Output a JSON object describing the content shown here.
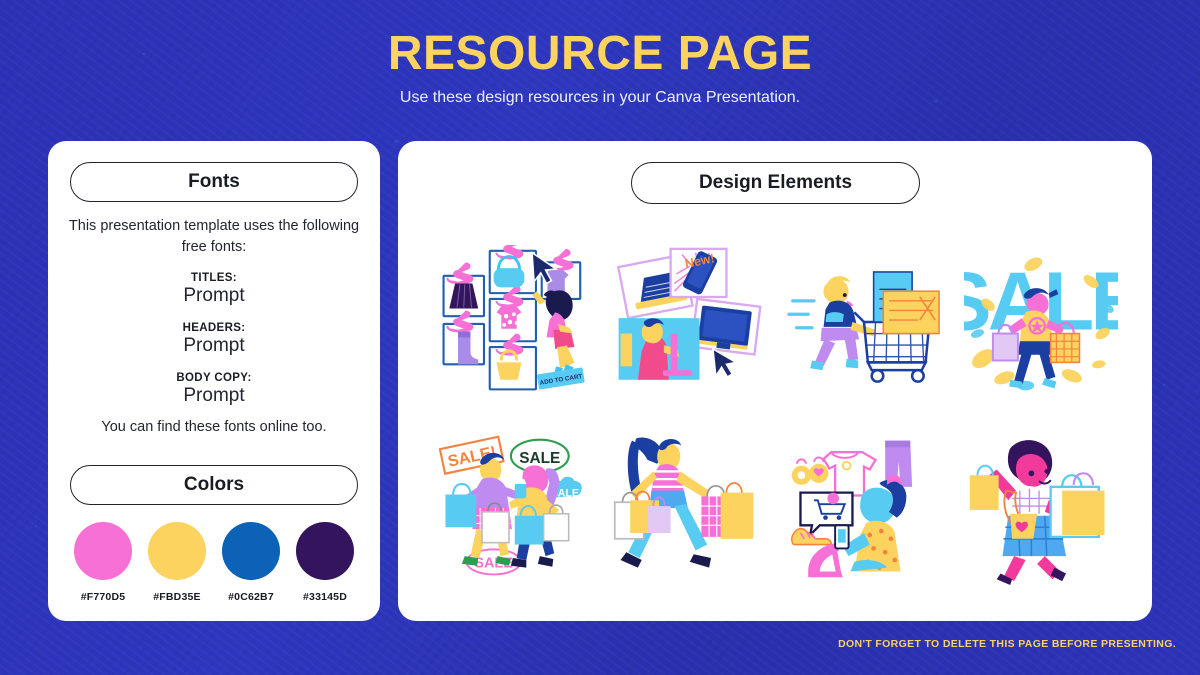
{
  "header": {
    "title": "RESOURCE PAGE",
    "subtitle": "Use these design resources in your Canva Presentation."
  },
  "left_panel": {
    "fonts_heading": "Fonts",
    "intro_text": "This presentation template uses the following free fonts:",
    "font_rows": [
      {
        "label": "TITLES:",
        "value": "Prompt"
      },
      {
        "label": "HEADERS:",
        "value": "Prompt"
      },
      {
        "label": "BODY COPY:",
        "value": "Prompt"
      }
    ],
    "outro_text": "You can find these fonts online too.",
    "colors_heading": "Colors",
    "swatches": [
      {
        "hex": "#F770D5",
        "label": "#F770D5"
      },
      {
        "hex": "#FBD35E",
        "label": "#FBD35E"
      },
      {
        "hex": "#0C62B7",
        "label": "#0C62B7"
      },
      {
        "hex": "#33145D",
        "label": "#33145D"
      }
    ]
  },
  "right_panel": {
    "elements_heading": "Design Elements",
    "illustrations": [
      {
        "name": "online-shopping-product-grid-illustration",
        "caption_text": "ADD TO CART"
      },
      {
        "name": "electronics-shopping-devices-illustration",
        "caption_text": "NEW!"
      },
      {
        "name": "person-pushing-shopping-cart-illustration",
        "caption_text": ""
      },
      {
        "name": "sale-lettering-shopper-illustration",
        "caption_text": "SALE"
      },
      {
        "name": "two-friends-shopping-sale-signs-illustration",
        "caption_text": "SALE!"
      },
      {
        "name": "woman-walking-with-shopping-bags-illustration",
        "caption_text": ""
      },
      {
        "name": "mobile-shopping-app-illustration",
        "caption_text": ""
      },
      {
        "name": "happy-woman-with-shopping-bags-illustration",
        "caption_text": ""
      }
    ]
  },
  "footer": {
    "note": "DON'T FORGET TO DELETE THIS PAGE BEFORE PRESENTING."
  },
  "theme": {
    "background": "#2B32B2",
    "title_color": "#FBD35E",
    "card_background": "#FFFFFF",
    "text_color": "#23262F"
  }
}
